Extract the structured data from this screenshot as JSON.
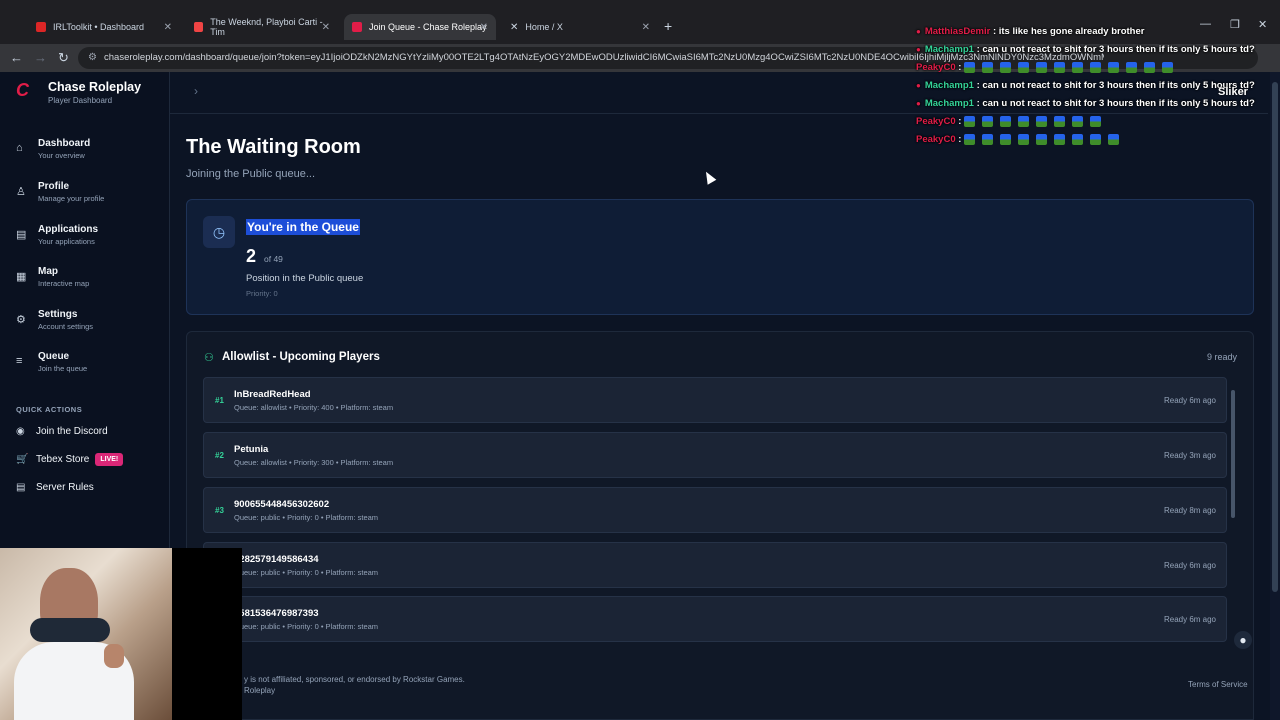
{
  "browser": {
    "tabs": [
      {
        "title": "IRLToolkit • Dashboard",
        "color": "#dc2626"
      },
      {
        "title": "The Weeknd, Playboi Carti - Tim",
        "color": "#ef4444"
      },
      {
        "title": "Join Queue - Chase Roleplay",
        "color": "#e11d48"
      },
      {
        "title": "Home / X",
        "color": "#ffffff"
      }
    ],
    "url": "chaseroleplay.com/dashboard/queue/join?token=eyJ1IjoiODZkN2MzNGYtYzliMy00OTE2LTg4OTAtNzEyOGY2MDEwODUzliwidCI6MCwiaSI6MTc2NzU0Mzg4OCwiZSI6MTc2NzU0NDE4OCwibiI6IjhiMjljMzc3NmNlNDY0Nzc3MzdmOWNmMmU1MzZkNmQ5In0"
  },
  "brand": {
    "title": "Chase Roleplay",
    "subtitle": "Player Dashboard"
  },
  "sidebar": {
    "items": [
      {
        "label": "Dashboard",
        "sub": "Your overview"
      },
      {
        "label": "Profile",
        "sub": "Manage your profile"
      },
      {
        "label": "Applications",
        "sub": "Your applications"
      },
      {
        "label": "Map",
        "sub": "Interactive map"
      },
      {
        "label": "Settings",
        "sub": "Account settings"
      },
      {
        "label": "Queue",
        "sub": "Join the queue"
      }
    ],
    "quick_actions_title": "QUICK ACTIONS",
    "quick_actions": [
      {
        "label": "Join the Discord"
      },
      {
        "label": "Tebex Store",
        "badge": "LIVE!"
      },
      {
        "label": "Server Rules"
      }
    ]
  },
  "main": {
    "title": "The Waiting Room",
    "subtitle": "Joining the Public queue...",
    "queue": {
      "title": "You're in the Queue",
      "position": "2",
      "of": "of 49",
      "desc": "Position in the Public queue",
      "priority": "Priority: 0"
    },
    "allowlist": {
      "title": "Allowlist - Upcoming Players",
      "ready": "9 ready",
      "rows": [
        {
          "num": "#1",
          "name": "InBreadRedHead",
          "meta": "Queue: allowlist • Priority: 400 • Platform: steam",
          "when": "Ready 6m ago"
        },
        {
          "num": "#2",
          "name": "Petunia",
          "meta": "Queue: allowlist • Priority: 300 • Platform: steam",
          "when": "Ready 3m ago"
        },
        {
          "num": "#3",
          "name": "900655448456302602",
          "meta": "Queue: public • Priority: 0 • Platform: steam",
          "when": "Ready 8m ago"
        },
        {
          "num": "",
          "name": "4282579149586434",
          "meta": "Queue: public • Priority: 0 • Platform: steam",
          "when": "Ready 6m ago"
        },
        {
          "num": "",
          "name": "1581536476987393",
          "meta": "Queue: public • Priority: 0 • Platform: steam",
          "when": "Ready 6m ago"
        }
      ]
    },
    "footer": {
      "line1": "y is not affiliated, sponsored, or endorsed by Rockstar Games.",
      "line2": "Roleplay",
      "terms": "Terms of Service"
    }
  },
  "chat": {
    "lines": [
      {
        "user": "MatthiasDemir",
        "msg": ": its like hes gone already brother"
      },
      {
        "user": "Machamp1",
        "msg": ": can u not react to shit for 3 hours then if its only 5 hours td?"
      },
      {
        "user": "PeakyC0",
        "msg": ":"
      },
      {
        "user": "Machamp1",
        "msg": ": can u not react to shit for 3 hours then if its only 5 hours td?"
      },
      {
        "user": "Machamp1",
        "msg": ": can u not react to shit for 3 hours then if its only 5 hours td?"
      },
      {
        "user": "PeakyC0",
        "msg": ":"
      },
      {
        "user": "PeakyC0",
        "msg": ":"
      }
    ],
    "overlay_name": "Sliker"
  }
}
